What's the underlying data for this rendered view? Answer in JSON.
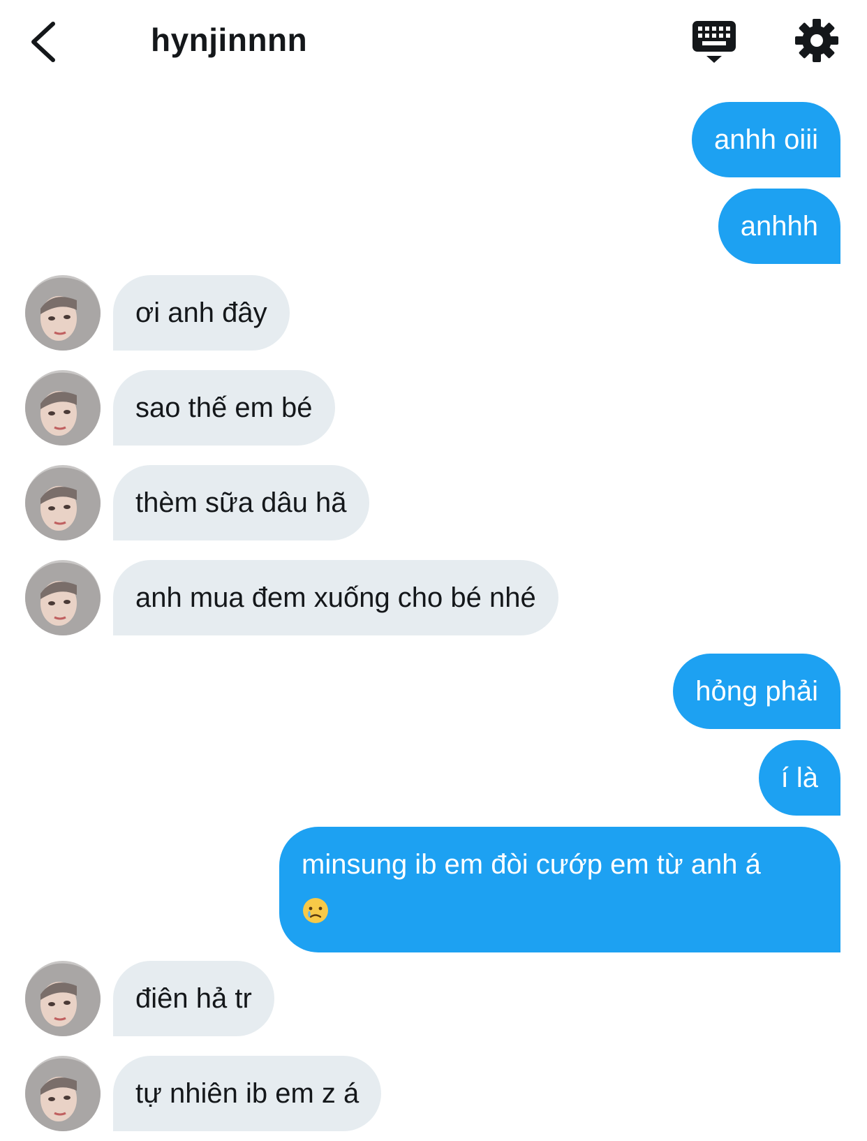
{
  "header": {
    "title": "hynjinnnn"
  },
  "messages": [
    {
      "side": "out",
      "text": "anhh oiii"
    },
    {
      "side": "out",
      "text": "anhhh"
    },
    {
      "side": "in",
      "text": "ơi anh đây"
    },
    {
      "side": "in",
      "text": "sao thế em bé"
    },
    {
      "side": "in",
      "text": "thèm sữa dâu hã"
    },
    {
      "side": "in",
      "text": "anh mua đem xuống cho bé nhé"
    },
    {
      "side": "out",
      "text": "hỏng phải"
    },
    {
      "side": "out",
      "text": "í là"
    },
    {
      "side": "out",
      "text": "minsung ib em đòi cướp em từ anh á",
      "emoji": "crying-face-emoji"
    },
    {
      "side": "in",
      "text": "điên hả tr"
    },
    {
      "side": "in",
      "text": "tự nhiên ib em z á"
    }
  ],
  "colors": {
    "outgoing_bubble": "#1da1f2",
    "incoming_bubble": "#e6ecf0",
    "text_dark": "#14171a"
  },
  "icons": {
    "back": "chevron-left-icon",
    "keyboard": "keyboard-icon",
    "settings": "gear-icon",
    "avatar": "avatar"
  }
}
